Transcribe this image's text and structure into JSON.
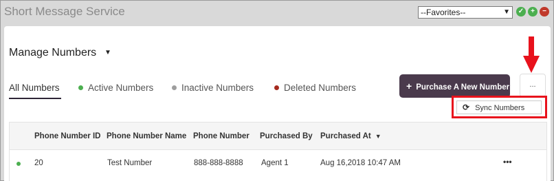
{
  "window": {
    "title": "Short Message Service"
  },
  "favorites": {
    "selected": "--Favorites--"
  },
  "header": {
    "title": "Manage Numbers"
  },
  "tabs": [
    {
      "label": "All Numbers",
      "dot_color": ""
    },
    {
      "label": "Active Numbers",
      "dot_color": "#4caf50"
    },
    {
      "label": "Inactive Numbers",
      "dot_color": "#9e9e9e"
    },
    {
      "label": "Deleted Numbers",
      "dot_color": "#a52a1e"
    }
  ],
  "actions": {
    "purchase_label": "Purchase A New Number",
    "more_label": "...",
    "sync_label": "Sync Numbers"
  },
  "table": {
    "columns": [
      "Phone Number ID",
      "Phone Number Name",
      "Phone Number",
      "Purchased By",
      "Purchased At"
    ],
    "rows": [
      {
        "status_color": "#4caf50",
        "id": "20",
        "name": "Test Number",
        "number": "888-888-8888",
        "purchased_by": "Agent 1",
        "purchased_at": "Aug 16,2018 10:47 AM",
        "more": "•••"
      }
    ]
  },
  "colors": {
    "accent": "#4a3a4c",
    "highlight": "#e8121c"
  }
}
